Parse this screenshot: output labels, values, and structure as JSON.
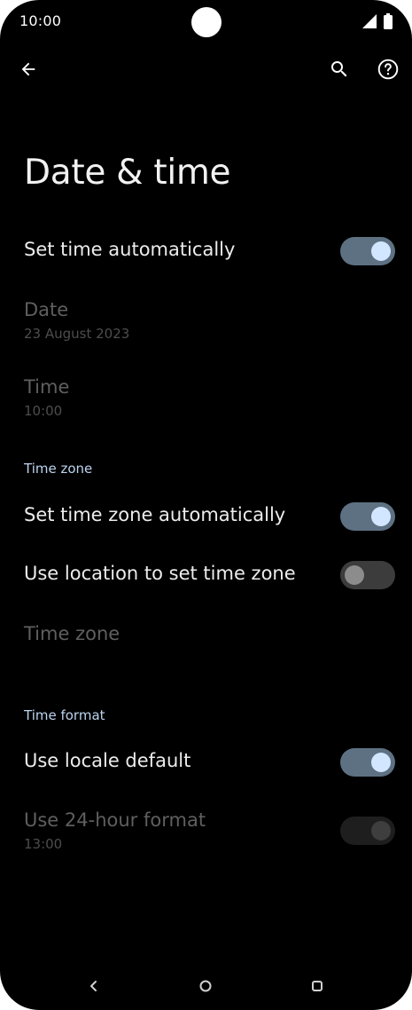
{
  "status_bar": {
    "time": "10:00"
  },
  "toolbar": {
    "back_icon": "arrow-back-icon",
    "search_icon": "search-icon",
    "help_icon": "help-circle-icon"
  },
  "page": {
    "title": "Date & time"
  },
  "settings": {
    "set_time_automatically": {
      "label": "Set time automatically",
      "state": "on"
    },
    "date": {
      "label": "Date",
      "value": "23 August 2023"
    },
    "time": {
      "label": "Time",
      "value": "10:00"
    },
    "time_zone_section": {
      "header": "Time zone"
    },
    "set_time_zone_automatically": {
      "label": "Set time zone automatically",
      "state": "on"
    },
    "use_location": {
      "label": "Use location to set time zone",
      "state": "off"
    },
    "time_zone": {
      "label": "Time zone"
    },
    "time_format_section": {
      "header": "Time format"
    },
    "use_locale_default": {
      "label": "Use locale default",
      "state": "on"
    },
    "use_24_hour": {
      "label": "Use 24-hour format",
      "value": "13:00",
      "state": "on-disabled"
    }
  },
  "nav_bar": {
    "back_icon": "nav-back-icon",
    "home_icon": "nav-home-icon",
    "recents_icon": "nav-recents-icon"
  },
  "colors": {
    "background": "#000000",
    "switch_track_on": "#5d7183",
    "switch_thumb_on": "#d2e7ff",
    "section_header": "#bcd3ee"
  }
}
